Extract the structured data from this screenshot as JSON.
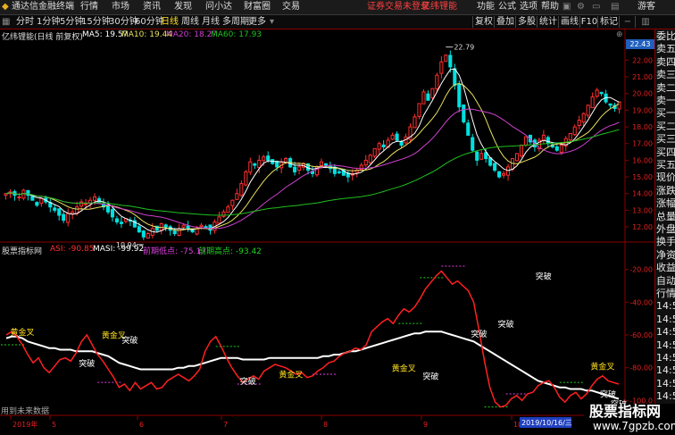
{
  "app": {
    "title": "通达信金融终端",
    "login_status": "证券交易未登录",
    "brand": "亿纬锂能"
  },
  "menu": [
    "行情",
    "市场",
    "资讯",
    "发现",
    "问小达",
    "财富圈",
    "交易"
  ],
  "menu_right": [
    "功能",
    "公式",
    "选项",
    "帮助",
    "游客"
  ],
  "periods": [
    "分时",
    "1分钟",
    "5分钟",
    "15分钟",
    "30分钟",
    "60分钟",
    "日线",
    "周线",
    "月线",
    "多周期",
    "更多"
  ],
  "period_active": "日线",
  "right_tools": [
    "复权",
    "叠加",
    "多股",
    "统计",
    "画线",
    "F10",
    "标记"
  ],
  "main_legend": {
    "title": "亿纬锂能(日线 前复权)",
    "ma5": "MA5: 19.57",
    "ma10": "MA10: 19.44",
    "ma20": "MA20: 18.27",
    "ma60": "MA60: 17.93"
  },
  "sub_legend": {
    "title": "股票指标网",
    "asi": "ASI: -90.85",
    "masi": "MASI: -99.92",
    "prev_low": "前期低点: -75.17",
    "prev_high": "前期高点: -93.42"
  },
  "price_axis": [
    "22.00",
    "21.00",
    "20.00",
    "19.00",
    "18.00",
    "17.00",
    "16.00",
    "15.00",
    "14.00",
    "13.00",
    "12.00"
  ],
  "current_price": "22.43",
  "sub_axis": [
    "-20.00",
    "-40.00",
    "-60.00",
    "-80.00",
    "-100.0"
  ],
  "annotations": {
    "high": "22.79",
    "low": "10.94",
    "gold": "黄金叉",
    "break": "突破",
    "no_data": "用到未来数据"
  },
  "date_axis": {
    "labels": [
      "2019年",
      "5",
      "6",
      "7",
      "8",
      "9",
      "10"
    ],
    "cursor_date": "2019/10/16/三"
  },
  "side_panel": [
    "委比",
    "卖五",
    "卖四",
    "卖三",
    "卖二",
    "卖一",
    "买一",
    "买二",
    "买三",
    "买四",
    "买五",
    "现价",
    "涨跌",
    "涨幅",
    "总量",
    "外盘",
    "换手",
    "净资",
    "收益",
    "自动",
    "行情",
    "14:5",
    "14:5",
    "14:5",
    "14:5",
    "14:5",
    "14:5",
    "14:5",
    "14:5"
  ],
  "watermark": {
    "title": "股票指标网",
    "url": "www.7gpzb.com"
  },
  "colors": {
    "up": "#ff3030",
    "down": "#00e0e0",
    "ma5": "#ffffff",
    "ma10": "#e8e060",
    "ma20": "#d040d0",
    "ma60": "#20c020",
    "asi": "#ff2020",
    "masi": "#ffffff"
  },
  "chart_data": [
    {
      "type": "candlestick",
      "title": "亿纬锂能(日线 前复权)",
      "ylim": [
        11.2,
        23.2
      ],
      "annotations": {
        "high": 22.79,
        "low": 10.94,
        "last": 22.43
      },
      "closes": [
        14.0,
        14.1,
        13.9,
        13.8,
        14.2,
        13.9,
        13.6,
        13.3,
        13.7,
        13.5,
        13.2,
        13.0,
        12.7,
        12.4,
        12.8,
        12.9,
        13.2,
        13.5,
        13.4,
        13.6,
        13.8,
        13.5,
        13.2,
        12.9,
        12.6,
        12.3,
        12.2,
        12.5,
        12.4,
        12.0,
        11.7,
        11.4,
        11.6,
        11.9,
        11.8,
        12.2,
        12.0,
        11.8,
        11.6,
        11.9,
        12.1,
        11.9,
        11.7,
        11.9,
        12.1,
        12.0,
        11.8,
        12.3,
        12.6,
        12.9,
        13.2,
        13.6,
        14.0,
        14.6,
        15.3,
        15.9,
        15.7,
        16.0,
        16.2,
        16.0,
        15.8,
        15.6,
        15.9,
        16.1,
        15.6,
        15.3,
        15.6,
        15.8,
        15.4,
        15.2,
        15.6,
        15.9,
        15.7,
        15.5,
        15.2,
        15.3,
        15.1,
        15.0,
        15.2,
        15.4,
        15.7,
        16.0,
        16.3,
        16.7,
        17.0,
        16.8,
        17.2,
        17.5,
        17.2,
        16.9,
        17.4,
        18.0,
        18.6,
        19.4,
        20.1,
        19.6,
        20.3,
        21.1,
        21.9,
        22.3,
        21.6,
        20.5,
        19.2,
        18.3,
        17.5,
        16.6,
        16.0,
        16.4,
        16.1,
        15.7,
        15.4,
        15.0,
        15.2,
        15.6,
        16.1,
        16.4,
        16.9,
        17.4,
        17.1,
        16.8,
        17.2,
        17.5,
        17.0,
        16.8,
        16.6,
        16.9,
        17.3,
        17.6,
        18.0,
        18.4,
        18.8,
        19.3,
        19.8,
        20.2,
        20.0,
        19.5,
        19.3,
        19.1,
        19.5
      ]
    },
    {
      "type": "line",
      "title": "股票指标网",
      "ylim": [
        -108,
        -12
      ],
      "series": [
        {
          "name": "ASI",
          "values": [
            -60,
            -58,
            -61,
            -66,
            -72,
            -77,
            -74,
            -80,
            -83,
            -79,
            -75,
            -74,
            -76,
            -71,
            -64,
            -60,
            -66,
            -72,
            -76,
            -81,
            -86,
            -92,
            -90,
            -94,
            -89,
            -93,
            -91,
            -89,
            -93,
            -92,
            -88,
            -86,
            -84,
            -86,
            -88,
            -85,
            -81,
            -70,
            -64,
            -61,
            -67,
            -74,
            -80,
            -85,
            -89,
            -87,
            -85,
            -87,
            -82,
            -80,
            -78,
            -79,
            -80,
            -82,
            -84,
            -83,
            -86,
            -85,
            -82,
            -80,
            -77,
            -76,
            -73,
            -71,
            -70,
            -68,
            -69,
            -66,
            -58,
            -55,
            -52,
            -50,
            -53,
            -48,
            -44,
            -46,
            -43,
            -38,
            -32,
            -28,
            -24,
            -21,
            -25,
            -29,
            -27,
            -30,
            -33,
            -40,
            -57,
            -76,
            -92,
            -101,
            -104,
            -103,
            -99,
            -97,
            -100,
            -96,
            -95,
            -91,
            -89,
            -88,
            -92,
            -98,
            -101,
            -97,
            -95,
            -99,
            -96,
            -91,
            -87,
            -85,
            -88,
            -89,
            -90
          ]
        },
        {
          "name": "MASI",
          "values": [
            -62,
            -61,
            -61,
            -62,
            -64,
            -65,
            -66,
            -67,
            -68,
            -68,
            -69,
            -69,
            -69,
            -70,
            -70,
            -70,
            -70,
            -71,
            -72,
            -73,
            -75,
            -77,
            -78,
            -79,
            -80,
            -81,
            -81,
            -81,
            -81,
            -81,
            -81,
            -81,
            -80,
            -80,
            -79,
            -79,
            -78,
            -77,
            -76,
            -75,
            -74,
            -74,
            -74,
            -74,
            -75,
            -75,
            -75,
            -75,
            -75,
            -74,
            -74,
            -74,
            -74,
            -74,
            -74,
            -74,
            -74,
            -74,
            -74,
            -73,
            -73,
            -72,
            -72,
            -71,
            -70,
            -70,
            -69,
            -68,
            -67,
            -66,
            -65,
            -64,
            -63,
            -62,
            -61,
            -60,
            -59,
            -59,
            -58,
            -58,
            -58,
            -58,
            -59,
            -60,
            -61,
            -62,
            -63,
            -64,
            -66,
            -68,
            -70,
            -72,
            -74,
            -76,
            -78,
            -80,
            -82,
            -84,
            -86,
            -88,
            -89,
            -90,
            -91,
            -92,
            -92,
            -93,
            -93,
            -93,
            -94,
            -94,
            -95,
            -96,
            -97,
            -98,
            -99
          ]
        }
      ]
    }
  ]
}
